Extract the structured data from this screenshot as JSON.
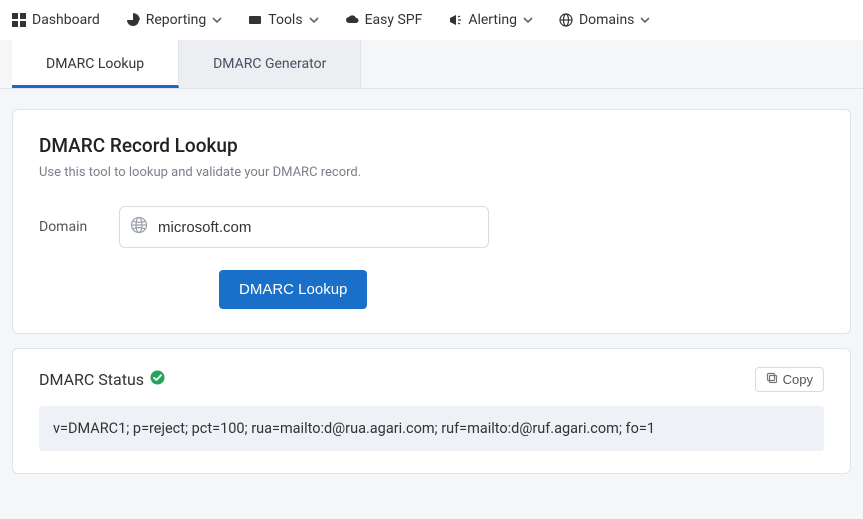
{
  "nav": {
    "dashboard": "Dashboard",
    "reporting": "Reporting",
    "tools": "Tools",
    "easy_spf": "Easy SPF",
    "alerting": "Alerting",
    "domains": "Domains"
  },
  "tabs": {
    "lookup": "DMARC Lookup",
    "generator": "DMARC Generator"
  },
  "lookup_card": {
    "title": "DMARC Record Lookup",
    "subtitle": "Use this tool to lookup and validate your DMARC record.",
    "domain_label": "Domain",
    "domain_value": "microsoft.com",
    "button_label": "DMARC Lookup"
  },
  "status_card": {
    "title": "DMARC Status",
    "copy_label": "Copy",
    "record": "v=DMARC1; p=reject; pct=100; rua=mailto:d@rua.agari.com; ruf=mailto:d@ruf.agari.com; fo=1"
  },
  "colors": {
    "primary": "#1a6fc9",
    "tab_active_border": "#2563c9",
    "success": "#22a55a"
  }
}
